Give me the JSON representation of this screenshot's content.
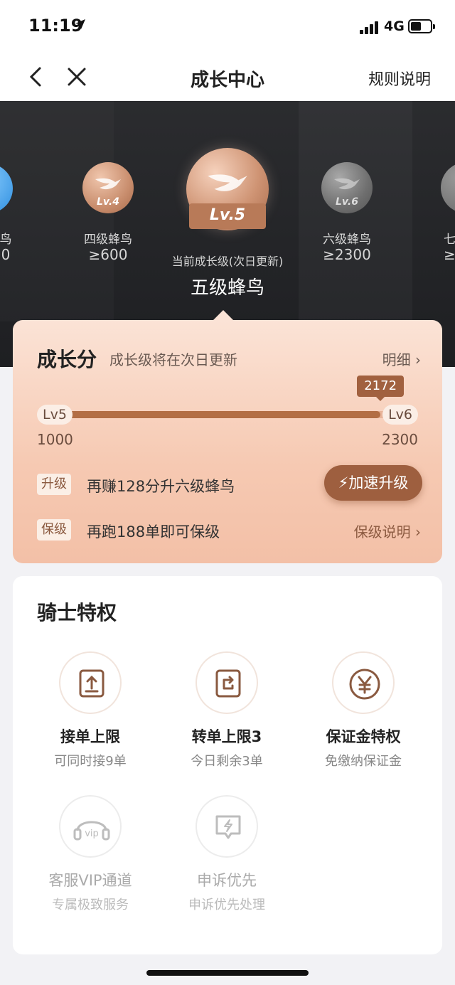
{
  "status_bar": {
    "time": "11:19",
    "network": "4G"
  },
  "nav": {
    "title": "成长中心",
    "rules_label": "规则说明"
  },
  "levels": [
    {
      "badge": "Lv.4",
      "name": "四级蜂鸟",
      "score": "≥600"
    },
    {
      "badge": "Lv.5",
      "current": true
    },
    {
      "badge": "Lv.6",
      "name": "六级蜂鸟",
      "score": "≥2300"
    }
  ],
  "partial_levels": {
    "left_name": "鸟",
    "left_score": "0",
    "right_name": "七",
    "right_score": "≥"
  },
  "current": {
    "label": "当前成长级(次日更新)",
    "name": "五级蜂鸟"
  },
  "growth": {
    "title": "成长分",
    "subtitle": "成长级将在次日更新",
    "detail_label": "明细",
    "current_score": "2172",
    "progress_fraction": 0.909,
    "from_level": "Lv5",
    "to_level": "Lv6",
    "from_score": "1000",
    "to_score": "2300",
    "upgrade_tag": "升级",
    "upgrade_text": "再赚128分升六级蜂鸟",
    "boost_label": "加速升级",
    "keep_tag": "保级",
    "keep_text": "再跑188单即可保级",
    "keep_link": "保级说明"
  },
  "privileges": {
    "title": "骑士特权",
    "items": [
      {
        "icon": "order-limit-icon",
        "title": "接单上限",
        "desc": "可同时接9单",
        "active": true
      },
      {
        "icon": "transfer-order-icon",
        "title": "转单上限3",
        "desc": "今日剩余3单",
        "active": true
      },
      {
        "icon": "yuan-deposit-icon",
        "title": "保证金特权",
        "desc": "免缴纳保证金",
        "active": true
      },
      {
        "icon": "vip-headset-icon",
        "title": "客服VIP通道",
        "desc": "专属极致服务",
        "active": false
      },
      {
        "icon": "appeal-chat-icon",
        "title": "申诉优先",
        "desc": "申诉优先处理",
        "active": false
      }
    ]
  },
  "colors": {
    "accent_brown": "#9e5f3f",
    "hero_bg": "#26272a",
    "card_peach": "#f6c9b2",
    "bronze": "#c98e6e",
    "silver": "#8a8a8a"
  }
}
